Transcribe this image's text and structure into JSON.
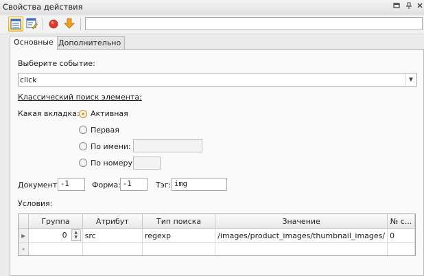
{
  "window": {
    "title": "Свойства действия",
    "controls": [
      "pin-window-icon",
      "pin-icon",
      "close-icon"
    ]
  },
  "toolbar": {
    "buttons": [
      "properties-view-icon",
      "edit-view-icon",
      "record-icon",
      "move-down-icon"
    ],
    "input_value": ""
  },
  "tabs": [
    {
      "label": "Основные",
      "active": true
    },
    {
      "label": "Дополнительно",
      "active": false
    }
  ],
  "event": {
    "label": "Выберите событие:",
    "value": "click"
  },
  "search": {
    "heading": "Классический поиск элемента:",
    "tab_label": "Какая вкладка:",
    "options": [
      {
        "label": "Активная",
        "checked": true
      },
      {
        "label": "Первая",
        "checked": false
      },
      {
        "label": "По имени:",
        "checked": false,
        "field_value": ""
      },
      {
        "label": "По номеру:",
        "checked": false,
        "field_value": ""
      }
    ]
  },
  "fields": {
    "document_label": "Документ:",
    "document_value": "-1",
    "form_label": "Форма:",
    "form_value": "-1",
    "tag_label": "Тэг:",
    "tag_value": "img"
  },
  "conditions": {
    "label": "Условия:",
    "columns": [
      "Группа",
      "Атрибут",
      "Тип поиска",
      "Значение",
      "№ с..."
    ],
    "rows": [
      {
        "group": "0",
        "attribute": "src",
        "search_type": "regexp",
        "value": "/images/product_images/thumbnail_images/",
        "number": "0"
      }
    ],
    "new_row_marker": "*"
  },
  "colors": {
    "accent": "#d6a13c",
    "record": "#e03a2e",
    "arrow": "#f0a020"
  }
}
